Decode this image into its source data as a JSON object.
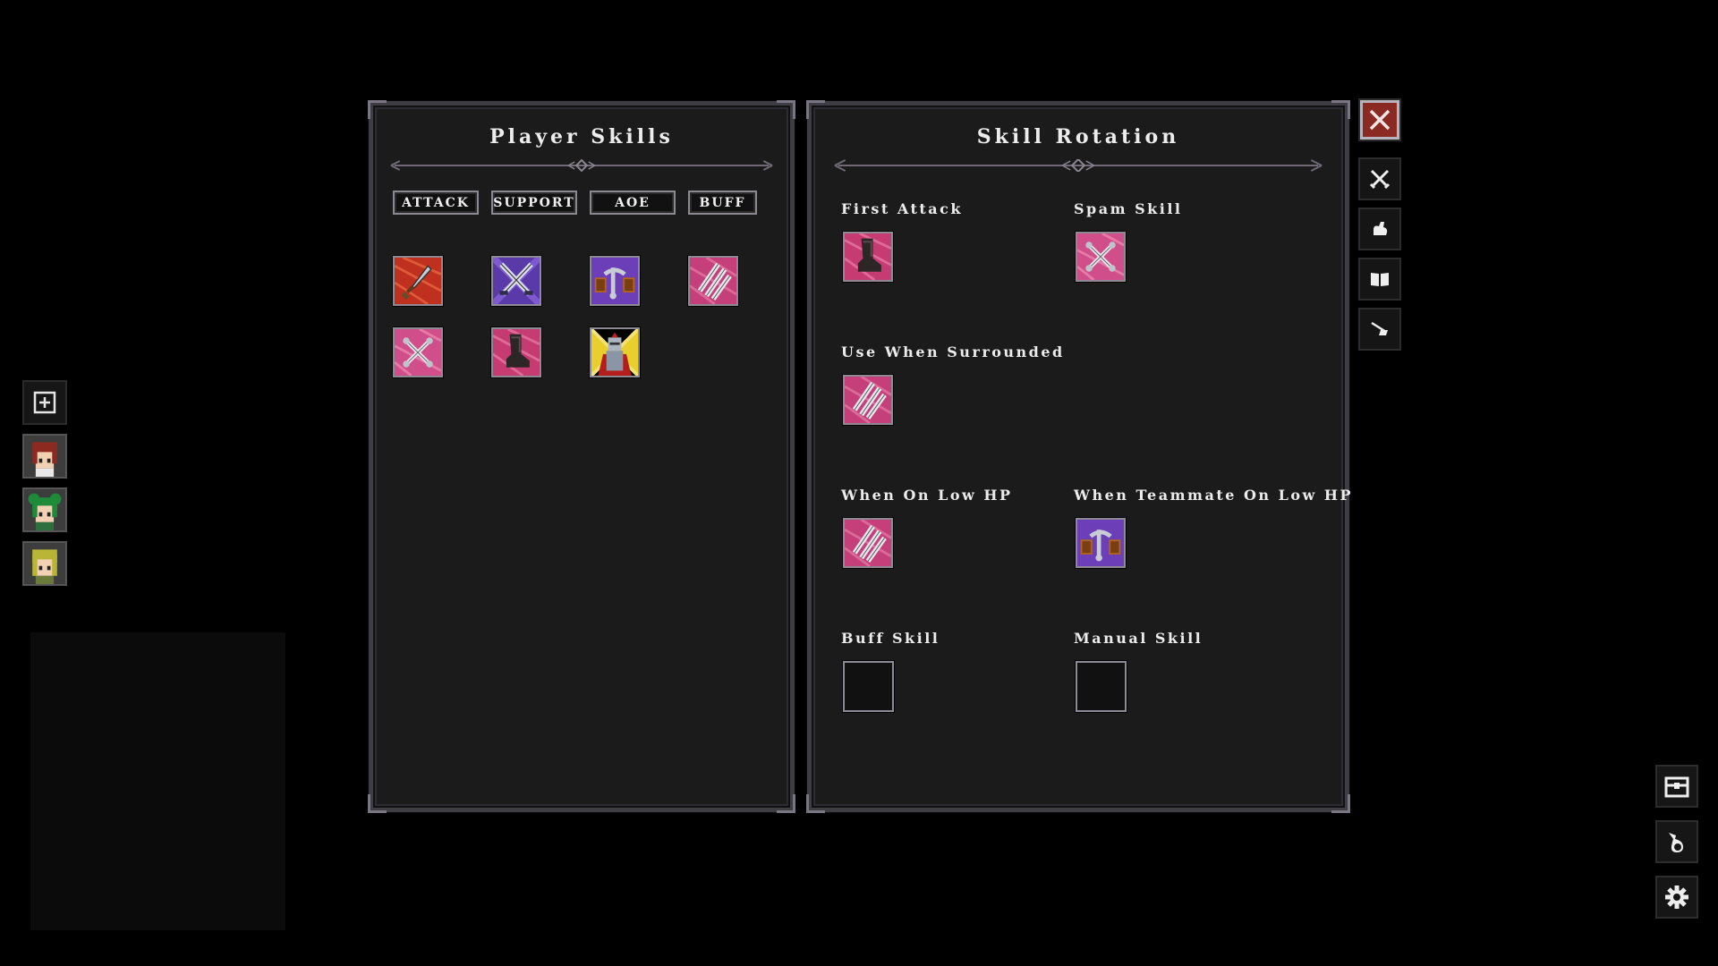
{
  "player_skills": {
    "title": "Player Skills",
    "tabs": [
      "ATTACK",
      "SUPPORT",
      "AOE",
      "BUFF"
    ],
    "skills": [
      {
        "icon": "red-sword-skill-icon"
      },
      {
        "icon": "crossed-swords-skill-icon"
      },
      {
        "icon": "chain-shackle-skill-icon"
      },
      {
        "icon": "claw-slash-skill-icon"
      },
      {
        "icon": "cross-strike-skill-icon"
      },
      {
        "icon": "boot-kick-skill-icon"
      },
      {
        "icon": "knight-portrait-skill-icon"
      }
    ]
  },
  "skill_rotation": {
    "title": "Skill Rotation",
    "slots": {
      "first_attack": {
        "label": "First Attack",
        "icon": "boot-kick-skill-icon"
      },
      "spam_skill": {
        "label": "Spam Skill",
        "icon": "cross-strike-skill-icon"
      },
      "surrounded": {
        "label": "Use When Surrounded",
        "icon": "claw-slash-skill-icon"
      },
      "low_hp": {
        "label": "When On Low HP",
        "icon": "claw-slash-skill-icon"
      },
      "teammate_low_hp": {
        "label": "When Teammate On Low HP",
        "icon": "chain-shackle-skill-icon"
      },
      "buff_skill": {
        "label": "Buff Skill",
        "icon": ""
      },
      "manual_skill": {
        "label": "Manual Skill",
        "icon": ""
      }
    }
  },
  "side_menu": [
    "swords-icon",
    "flexed-arm-icon",
    "open-book-icon",
    "fishing-icon"
  ],
  "party": [
    "add-party-icon",
    "red-hair-hero-avatar",
    "green-hair-hero-avatar",
    "blonde-hero-avatar"
  ],
  "bottom_menu": [
    "treasure-chest-icon",
    "potion-icon",
    "settings-gear-icon"
  ],
  "colors": {
    "panel_bg": "#1b1b1c",
    "panel_border": "#3f3d44",
    "close_button": "#8a2a22",
    "text": "#ececec"
  }
}
